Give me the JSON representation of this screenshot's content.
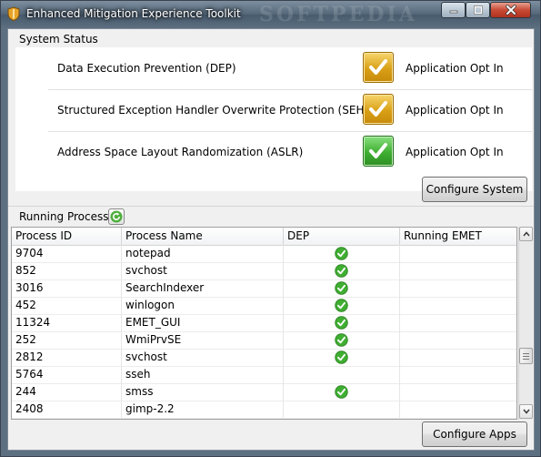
{
  "window": {
    "title": "Enhanced Mitigation Experience Toolkit",
    "watermark": "SOFTPEDIA",
    "icon": "emet-app-icon"
  },
  "system_status": {
    "label": "System Status",
    "items": [
      {
        "name": "Data Execution Prevention (DEP)",
        "value": "Application Opt In",
        "icon": "check-yellow-icon",
        "color": "#d9a016"
      },
      {
        "name": "Structured Exception Handler Overwrite Protection (SEHOP)",
        "value": "Application Opt In",
        "icon": "check-yellow-icon",
        "color": "#d9a016"
      },
      {
        "name": "Address Space Layout Randomization (ASLR)",
        "value": "Application Opt In",
        "icon": "check-green-icon",
        "color": "#3fae31"
      }
    ],
    "configure_button": "Configure System"
  },
  "running_processes": {
    "label": "Running Processes",
    "refresh_icon": "refresh-icon",
    "columns": [
      "Process ID",
      "Process Name",
      "DEP",
      "Running EMET"
    ],
    "rows": [
      {
        "pid": "9704",
        "name": "notepad",
        "dep": true,
        "emet": ""
      },
      {
        "pid": "852",
        "name": "svchost",
        "dep": true,
        "emet": ""
      },
      {
        "pid": "3016",
        "name": "SearchIndexer",
        "dep": true,
        "emet": ""
      },
      {
        "pid": "452",
        "name": "winlogon",
        "dep": true,
        "emet": ""
      },
      {
        "pid": "11324",
        "name": "EMET_GUI",
        "dep": true,
        "emet": ""
      },
      {
        "pid": "252",
        "name": "WmiPrvSE",
        "dep": true,
        "emet": ""
      },
      {
        "pid": "2812",
        "name": "svchost",
        "dep": true,
        "emet": ""
      },
      {
        "pid": "5764",
        "name": "sseh",
        "dep": false,
        "emet": ""
      },
      {
        "pid": "244",
        "name": "smss",
        "dep": true,
        "emet": ""
      },
      {
        "pid": "2408",
        "name": "gimp-2.2",
        "dep": false,
        "emet": ""
      }
    ],
    "configure_button": "Configure Apps",
    "scroll_position": 0.72
  },
  "colors": {
    "accent_green": "#3fae31",
    "accent_yellow": "#d9a016",
    "titlebar": "#55687a",
    "close_button": "#c74a34"
  }
}
